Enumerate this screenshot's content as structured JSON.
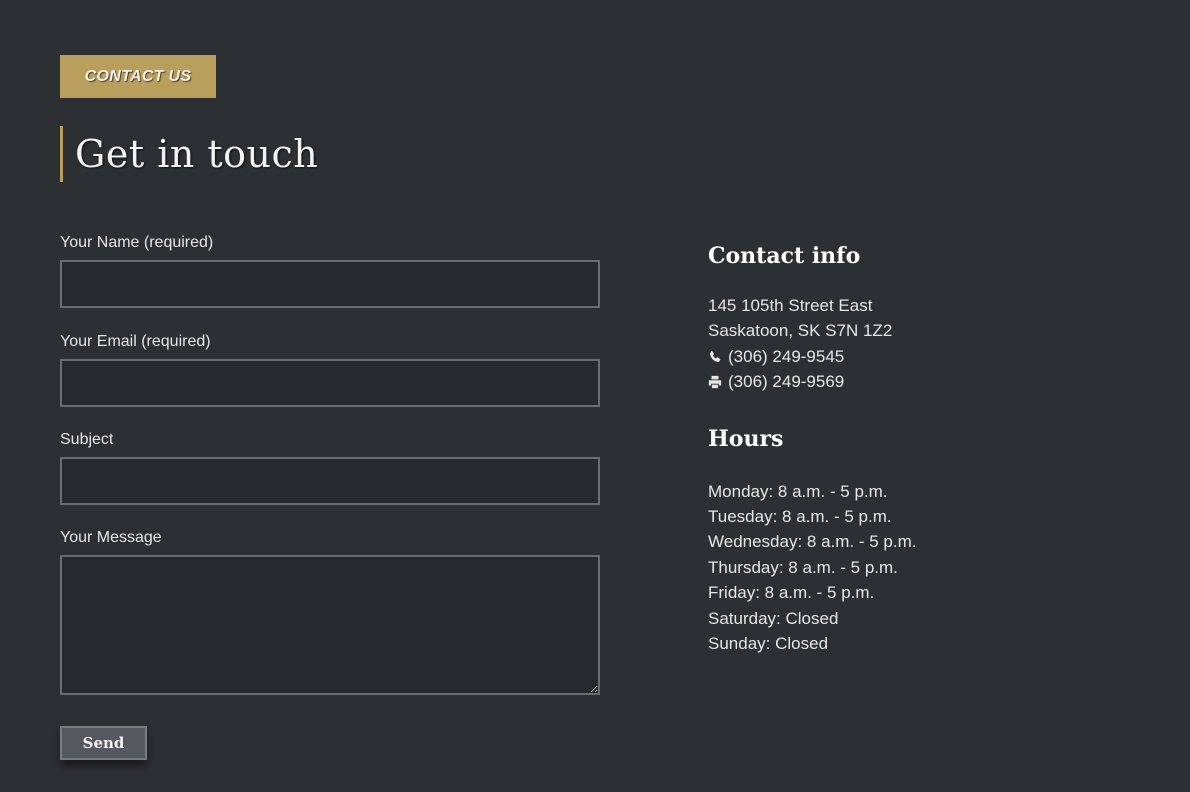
{
  "badge": {
    "label": "CONTACT US"
  },
  "heading": "Get in touch",
  "form": {
    "name_label": "Your Name (required)",
    "name_value": "",
    "email_label": "Your Email (required)",
    "email_value": "",
    "subject_label": "Subject",
    "subject_value": "",
    "message_label": "Your Message",
    "message_value": "",
    "send_label": "Send"
  },
  "contact": {
    "title": "Contact info",
    "address_line1": "145 105th Street East",
    "address_line2": "Saskatoon, SK S7N 1Z2",
    "phone": "(306) 249-9545",
    "phone_icon": "phone-icon",
    "fax": "(306) 249-9569",
    "fax_icon": "printer-icon"
  },
  "hours": {
    "title": "Hours",
    "days": [
      "Monday: 8 a.m. - 5 p.m.",
      "Tuesday: 8 a.m. - 5 p.m.",
      "Wednesday: 8 a.m. - 5 p.m.",
      "Thursday: 8 a.m. - 5 p.m.",
      "Friday: 8 a.m. - 5 p.m.",
      "Saturday: Closed",
      "Sunday: Closed"
    ]
  },
  "colors": {
    "background": "#2d3033",
    "accent": "#b89f5c",
    "input_border": "#6a6d70",
    "button": "#55585c"
  }
}
